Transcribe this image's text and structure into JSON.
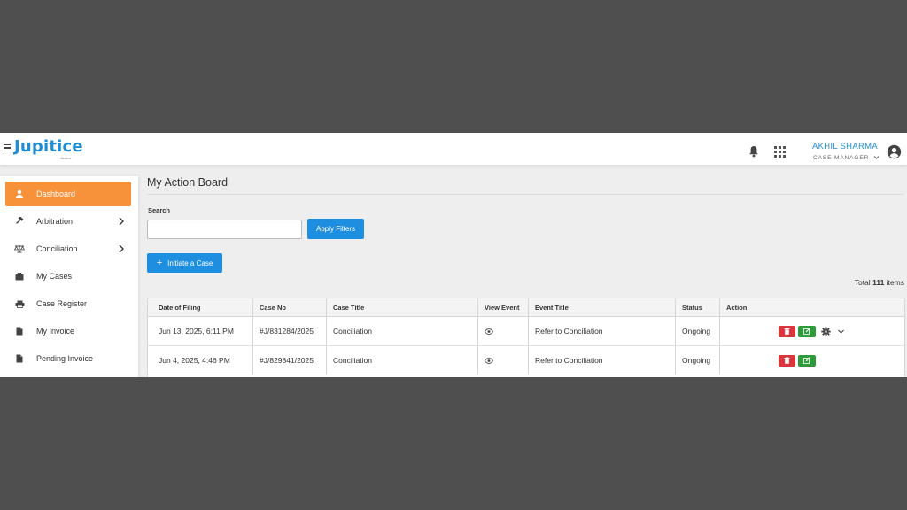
{
  "header": {
    "logo_text": "Jupitice",
    "logo_subtext": "Justice",
    "user_name": "AKHIL SHARMA",
    "user_role": "CASE MANAGER",
    "accent_color": "#1e8fd6"
  },
  "sidebar": {
    "active_color": "#f7923a",
    "items": [
      {
        "label": "Dashboard",
        "icon": "user-icon",
        "active": true
      },
      {
        "label": "Arbitration",
        "icon": "gavel-icon",
        "has_submenu": true
      },
      {
        "label": "Conciliation",
        "icon": "scale-icon",
        "has_submenu": true
      },
      {
        "label": "My Cases",
        "icon": "briefcase-icon"
      },
      {
        "label": "Case Register",
        "icon": "printer-icon"
      },
      {
        "label": "My Invoice",
        "icon": "document-icon"
      },
      {
        "label": "Pending Invoice",
        "icon": "document-icon"
      }
    ]
  },
  "main": {
    "title": "My Action Board",
    "search_label": "Search",
    "search_value": "",
    "apply_label": "Apply Filters",
    "initiate_label": "Initiate a Case",
    "total_prefix": "Total",
    "total_count": "111",
    "total_suffix": "items"
  },
  "table": {
    "columns": [
      "Date of Filing",
      "Case No",
      "Case Title",
      "View Event",
      "Event Title",
      "Status",
      "Action"
    ],
    "rows": [
      {
        "date": "Jun 13, 2025, 6:11 PM",
        "case_no": "#J/831284/2025",
        "title": "Conciliation",
        "event_title": "Refer to Conciliation",
        "status": "Ongoing",
        "extra_actions": true
      },
      {
        "date": "Jun 4, 2025, 4:46 PM",
        "case_no": "#J/829841/2025",
        "title": "Conciliation",
        "event_title": "Refer to Conciliation",
        "status": "Ongoing",
        "extra_actions": false
      }
    ]
  }
}
